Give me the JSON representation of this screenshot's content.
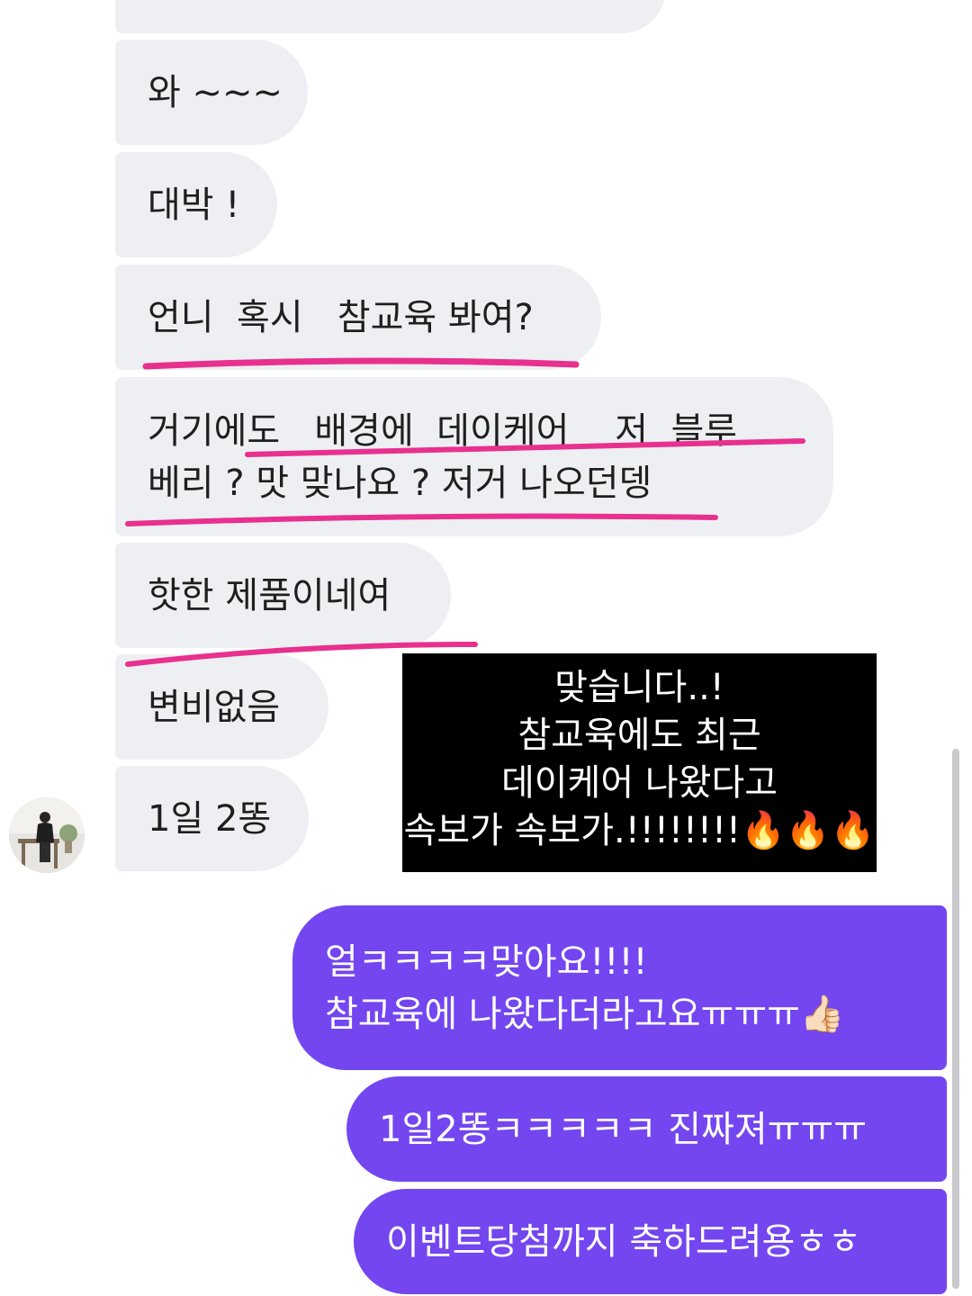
{
  "received_messages": [
    "",
    "와 ~~~",
    "대박 !",
    "언니  혹시   참교육 봐여?",
    "거기에도   배경에  데이케어    저  블루",
    "베리 ? 맛 맞나요 ? 저거 나오던뎅",
    "핫한 제품이네여",
    "변비없음",
    "1일 2똥"
  ],
  "overlay_caption": [
    "맞습니다..!",
    "참교육에도 최근",
    "데이케어 나왔다고",
    "속보가 속보가.!!!!!!!!🔥🔥🔥"
  ],
  "sent_messages": [
    "얼ㅋㅋㅋㅋ맞아요!!!!",
    "참교육에 나왔다더라고요ㅠㅠㅠ👍🏻",
    "1일2똥ㅋㅋㅋㅋㅋ 진짜져ㅠㅠㅠ",
    "이벤트당첨까지 축하드려용ㅎㅎ"
  ],
  "colors": {
    "received_bubble": "#eeeff2",
    "sent_bubble": "#7346f0",
    "underline": "#e8308e",
    "overlay_bg": "#000000"
  }
}
